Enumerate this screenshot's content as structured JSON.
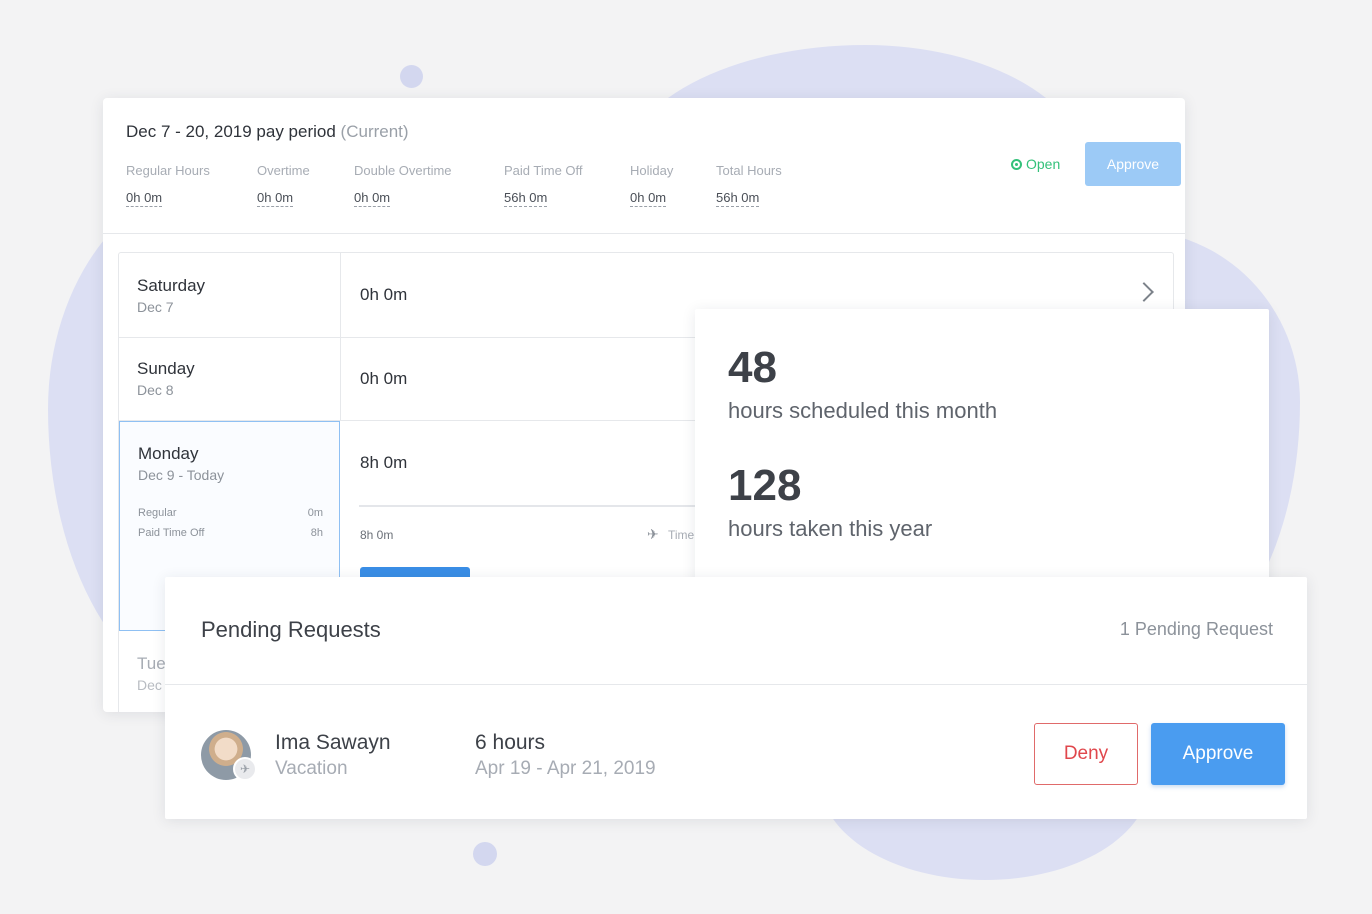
{
  "pay_period": {
    "title": "Dec 7 - 20, 2019 pay period",
    "title_suffix": "(Current)",
    "stats": [
      {
        "label": "Regular Hours",
        "value": "0h 0m"
      },
      {
        "label": "Overtime",
        "value": "0h 0m"
      },
      {
        "label": "Double Overtime",
        "value": "0h 0m"
      },
      {
        "label": "Paid Time Off",
        "value": "56h 0m"
      },
      {
        "label": "Holiday",
        "value": "0h 0m"
      },
      {
        "label": "Total Hours",
        "value": "56h 0m"
      }
    ],
    "status": "Open",
    "approve_label": "Approve"
  },
  "days": [
    {
      "name": "Saturday",
      "date": "Dec 7",
      "hours": "0h 0m"
    },
    {
      "name": "Sunday",
      "date": "Dec 8",
      "hours": "0h 0m"
    },
    {
      "name": "Monday",
      "date": "Dec 9 - Today",
      "hours": "8h 0m",
      "breakdown": [
        {
          "label": "Regular",
          "value": "0m"
        },
        {
          "label": "Paid Time Off",
          "value": "8h"
        }
      ],
      "detail_hours": "8h 0m",
      "detail_type": "Time"
    },
    {
      "name": "Tue",
      "date": "Dec"
    }
  ],
  "stats_card": {
    "scheduled_value": "48",
    "scheduled_caption": "hours scheduled this month",
    "taken_value": "128",
    "taken_caption": "hours taken this year"
  },
  "pending": {
    "title": "Pending Requests",
    "count_label": "1 Pending Request",
    "request": {
      "name": "Ima Sawayn",
      "type": "Vacation",
      "hours": "6 hours",
      "dates": "Apr 19 - Apr 21, 2019",
      "deny_label": "Deny",
      "approve_label": "Approve"
    }
  },
  "colors": {
    "accent": "#4a9cf0",
    "open_status": "#33c17a",
    "deny": "#e0474c",
    "blob": "#dcdff3"
  }
}
